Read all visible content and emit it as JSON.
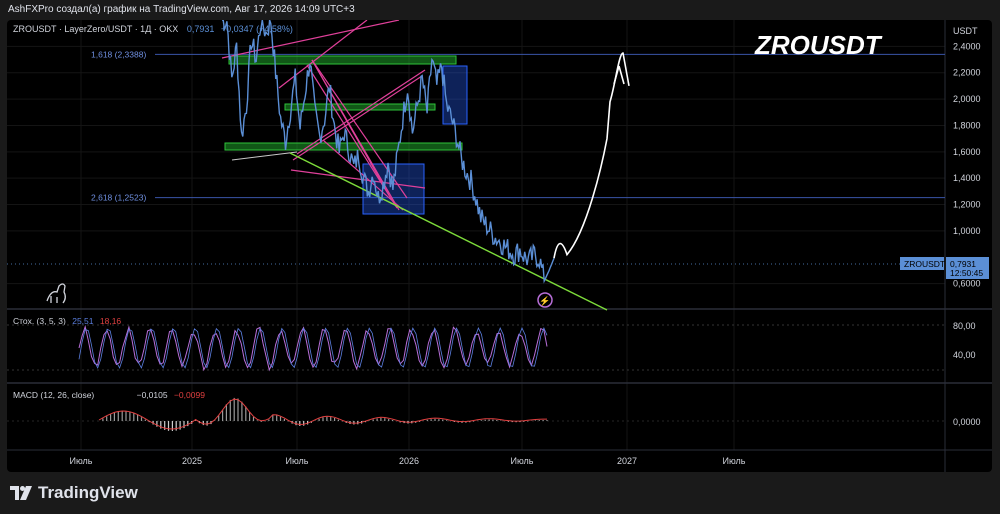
{
  "header_text": "AshFXPro создал(а) график на TradingView.com, Авг 17, 2026 14:09 UTC+3",
  "symbol_line": "ZROUSDT · LayerZero/USDT · 1Д · OKX",
  "symbol_price": "0,7931",
  "symbol_change": "+0,0347 (+4,58%)",
  "watermark": "ZROUSDT",
  "currency": "USDT",
  "price_tag": {
    "symbol": "ZROUSDT",
    "price": "0,7931",
    "countdown": "12:50:45"
  },
  "fib_levels": [
    {
      "label": "1,618 (2,3388)",
      "value": 2.3388
    },
    {
      "label": "2,618 (1,2523)",
      "value": 1.2523
    }
  ],
  "stoch": {
    "name": "Стох. (3, 5, 3)",
    "k": "25,51",
    "d": "18,16",
    "ticks": [
      "80,00",
      "40,00"
    ]
  },
  "macd": {
    "name": "MACD (12, 26, close)",
    "v1": "−0,0105",
    "v2": "−0,0099",
    "tick": "0,0000"
  },
  "brand": "TradingView",
  "colors": {
    "price": "#5b8fd6",
    "stoch_k": "#b86fd9",
    "stoch_d": "#5b7fe0",
    "macd": "#e04040",
    "fib": "#3a55a8",
    "support": "#7ddb3a",
    "zone": "#1fa02a",
    "pink": "#e0409a"
  },
  "chart_data": {
    "type": "line",
    "ylim": [
      0.4,
      2.6
    ],
    "y_ticks": [
      "2,4000",
      "2,2000",
      "2,0000",
      "1,8000",
      "1,6000",
      "1,4000",
      "1,2000",
      "1,0000",
      "0,6000"
    ],
    "x_ticks": [
      "Июль",
      "2025",
      "Июль",
      "2026",
      "Июль",
      "2027",
      "Июль"
    ],
    "series": [
      {
        "values": [
          2.6,
          2.6,
          2.15,
          2.4,
          1.72,
          1.95,
          2.45,
          2.3,
          2.6,
          2.5,
          2.6,
          2.2,
          1.85,
          1.68,
          1.92,
          2.15,
          1.78,
          2.05,
          2.3,
          1.9,
          1.72,
          1.85,
          2.1,
          1.8,
          1.6,
          1.75,
          1.62,
          1.48,
          1.58,
          1.4,
          1.3,
          1.45,
          1.25,
          1.35,
          1.52,
          1.32,
          1.58,
          1.85,
          2.1,
          1.75,
          1.95,
          2.15,
          1.9,
          2.3,
          2.1,
          2.25,
          1.95,
          1.85,
          1.72,
          1.55,
          1.45,
          1.38,
          1.25,
          1.1,
          1.05,
          1.0,
          0.95,
          0.92,
          0.88,
          0.85,
          0.82,
          0.86,
          0.8,
          0.78,
          0.82,
          0.79,
          0.62,
          0.7,
          0.7931
        ]
      }
    ],
    "projection": [
      0.7931,
      0.9,
      1.2,
      1.7,
      2.35,
      2.1
    ]
  }
}
